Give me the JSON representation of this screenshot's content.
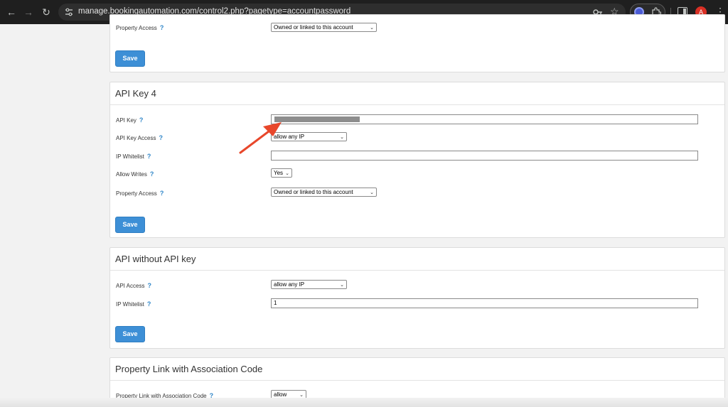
{
  "browser": {
    "url": "manage.bookingautomation.com/control2.php?pagetype=accountpassword",
    "avatar_letter": "A",
    "icons": [
      "back-arrow-icon",
      "forward-arrow-icon",
      "reload-icon",
      "site-settings-icon",
      "password-key-icon",
      "bookmark-star-icon",
      "extension-icon",
      "puzzle-icon",
      "side-panel-icon",
      "menu-kebab-icon"
    ]
  },
  "help_mark": "?",
  "panel_top": {
    "property_access_label": "Property Access",
    "property_access_value": "Owned or linked to this account",
    "save_label": "Save"
  },
  "panel_key4": {
    "title": "API Key 4",
    "api_key_label": "API Key",
    "api_key_access_label": "API Key Access",
    "api_key_access_value": "allow any IP",
    "ip_whitelist_label": "IP Whitelist",
    "ip_whitelist_value": "",
    "allow_writes_label": "Allow Writes",
    "allow_writes_value": "Yes",
    "property_access_label": "Property Access",
    "property_access_value": "Owned or linked to this account",
    "save_label": "Save"
  },
  "panel_nokey": {
    "title": "API without API key",
    "api_access_label": "API Access",
    "api_access_value": "allow any IP",
    "ip_whitelist_label": "IP Whitelist",
    "ip_whitelist_value": "1",
    "save_label": "Save"
  },
  "panel_link": {
    "title": "Property Link with Association Code",
    "link_label": "Property Link with Association Code",
    "link_value": "allow"
  },
  "colors": {
    "accent_button": "#3d8fd6",
    "help_mark": "#2f86c8",
    "annotation_arrow": "#e8472b"
  }
}
